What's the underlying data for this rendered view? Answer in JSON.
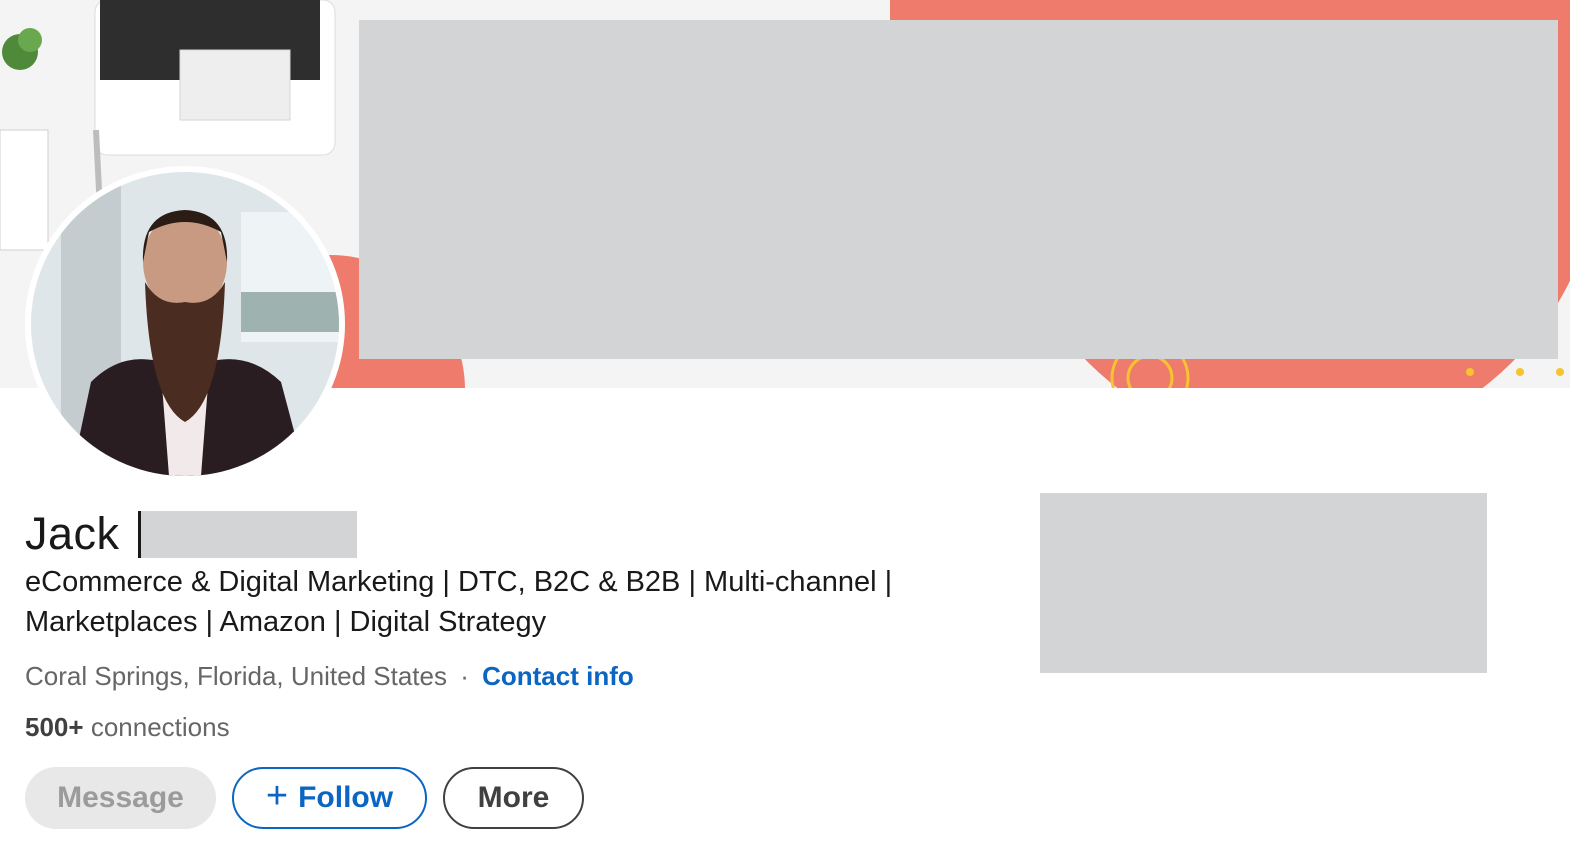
{
  "profile": {
    "first_name": "Jack",
    "headline": "eCommerce & Digital Marketing | DTC, B2C & B2B | Multi-channel | Marketplaces | Amazon | Digital Strategy",
    "location": "Coral Springs, Florida, United States",
    "separator": "·",
    "contact_label": "Contact info",
    "connections_count": "500+",
    "connections_label": "connections"
  },
  "actions": {
    "message_label": "Message",
    "follow_icon": "+",
    "follow_label": "Follow",
    "more_label": "More"
  },
  "icons": {
    "avatar": "profile-photo",
    "follow": "plus-icon"
  },
  "colors": {
    "accent": "#0a66c2",
    "banner_coral": "#ee7b6b",
    "redaction": "#d3d4d6"
  }
}
